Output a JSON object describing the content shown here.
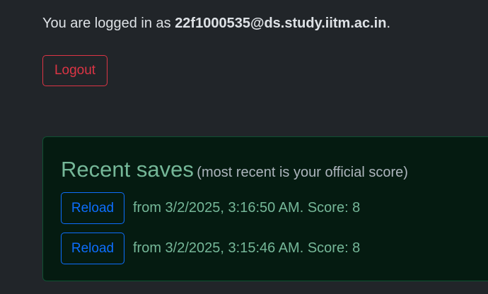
{
  "login": {
    "prefix": "You are logged in as ",
    "email": "22f1000535@ds.study.iitm.ac.in",
    "suffix": "."
  },
  "logout_label": "Logout",
  "recent": {
    "title": "Recent saves",
    "subtitle": "(most recent is your official score)",
    "saves": [
      {
        "button": "Reload",
        "text": "from 3/2/2025, 3:16:50 AM. Score: 8"
      },
      {
        "button": "Reload",
        "text": "from 3/2/2025, 3:15:46 AM. Score: 8"
      }
    ]
  },
  "colors": {
    "background": "#212529",
    "danger": "#dc3545",
    "primary": "#0d6efd",
    "success_text": "#75b798",
    "success_bg": "#051b11"
  }
}
